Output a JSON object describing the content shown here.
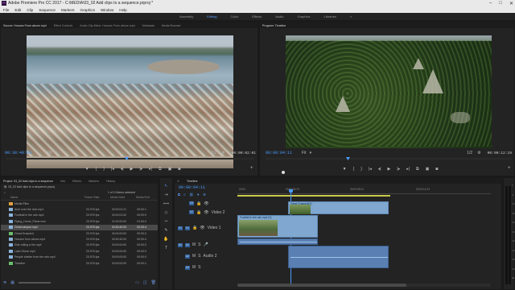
{
  "window": {
    "title": "Adobe Premiere Pro CC 2017 - C:\\MEDIA\\03_02 Add clips to a sequence.prproj *",
    "app_icon": "Pr",
    "controls": [
      "–",
      "□",
      "✕"
    ]
  },
  "menu": [
    "File",
    "Edit",
    "Clip",
    "Sequence",
    "Markers",
    "Graphics",
    "Window",
    "Help"
  ],
  "workspaces": {
    "items": [
      "Assembly",
      "Editing",
      "Color",
      "Effects",
      "Audio",
      "Graphics",
      "Libraries"
    ],
    "active": "Editing",
    "more": "»"
  },
  "source_monitor": {
    "tabs": [
      "Source: Houses From above.mp4",
      "Effect Controls",
      "Audio Clip Mixer: Houses From above.mp4",
      "Metadata",
      "Media Browser"
    ],
    "timecode": "00:30:40:03",
    "fit": "Fit",
    "resolution": "1/2",
    "duration": "00:00:02:01"
  },
  "program_monitor": {
    "tabs": [
      "Program: Timeline"
    ],
    "timecode": "00:00:04:11",
    "fit": "Fit",
    "resolution": "1/2",
    "duration": "00:00:12:19"
  },
  "project_panel": {
    "tabs": [
      "Project: 03_02 Add clips to a sequence",
      "Info",
      "Effects",
      "Markers",
      "History"
    ],
    "path": "03_02 Add clips to a sequence.prproj",
    "count": "1 of 13 items selected",
    "columns": [
      "Name",
      "Frame Rate",
      "Media Start",
      "Media End"
    ],
    "items": [
      {
        "name": "Media Files",
        "fps": "",
        "start": "",
        "end": "",
        "color": "#e0a040",
        "selected": false
      },
      {
        "name": "Arch over the river.mp4",
        "fps": "23.976 fps",
        "start": "00:00:01:21",
        "end": "00:00:1",
        "color": "#8ab3d9",
        "selected": false
      },
      {
        "name": "Football in the rain.mp4",
        "fps": "23.976 fps",
        "start": "00:00:01:02",
        "end": "00:00:0",
        "color": "#8ab3d9",
        "selected": false
      },
      {
        "name": "Flying_Home_Plane.mov",
        "fps": "23.976 fps",
        "start": "01:00:00:00",
        "end": "01:00:0",
        "color": "#8ab3d9",
        "selected": false
      },
      {
        "name": "Great canyon.mp4",
        "fps": "23.976 fps",
        "start": "00:30:40:03",
        "end": "00:30:4",
        "color": "#8ab3d9",
        "selected": true
      },
      {
        "name": "Great Grasslnd",
        "fps": "23.976 fps",
        "start": "00:00:00:00",
        "end": "00:00:0",
        "color": "#6bbf6b",
        "selected": false
      },
      {
        "name": "Houses from above.mp4",
        "fps": "23.976 fps",
        "start": "00:30:40:03",
        "end": "00:30:4",
        "color": "#8ab3d9",
        "selected": false
      },
      {
        "name": "Kids rolling a tire.mp4",
        "fps": "23.976 fps",
        "start": "00:00:00:00",
        "end": "00:00:0",
        "color": "#8ab3d9",
        "selected": false
      },
      {
        "name": "Lake Shore.mp4",
        "fps": "23.976 fps",
        "start": "00:00:00:00",
        "end": "00:00:0",
        "color": "#8ab3d9",
        "selected": false
      },
      {
        "name": "People shelter from the rain.mp4",
        "fps": "23.976 fps",
        "start": "00:00:00:00",
        "end": "00:00:0",
        "color": "#8ab3d9",
        "selected": false
      },
      {
        "name": "Timeline",
        "fps": "23.976 fps",
        "start": "00:00:00:00",
        "end": "00:00:1",
        "color": "#6bbf6b",
        "selected": false
      }
    ]
  },
  "timeline": {
    "tab": "Timeline",
    "timecode": "00:00:04:11",
    "ruler": [
      "00:00",
      "00:00:04:23",
      "00:00:09:23",
      "00:00:14:23"
    ],
    "tracks": [
      {
        "id": "V3",
        "label": ""
      },
      {
        "id": "V2",
        "label": "Video 2"
      },
      {
        "id": "V1",
        "label": "Video 1"
      },
      {
        "id": "A1",
        "label": "Audio 1"
      },
      {
        "id": "A2",
        "label": "Audio 2"
      },
      {
        "id": "A3",
        "label": ""
      }
    ],
    "clips": {
      "v2": "Great Grasslnd[V]",
      "v1": "Football in the rain.mp4 [V]"
    },
    "meter_labels": [
      "0",
      "-6",
      "-12",
      "-18",
      "-24",
      "-30",
      "-36",
      "-42",
      "-48",
      "-54",
      "dB"
    ]
  }
}
